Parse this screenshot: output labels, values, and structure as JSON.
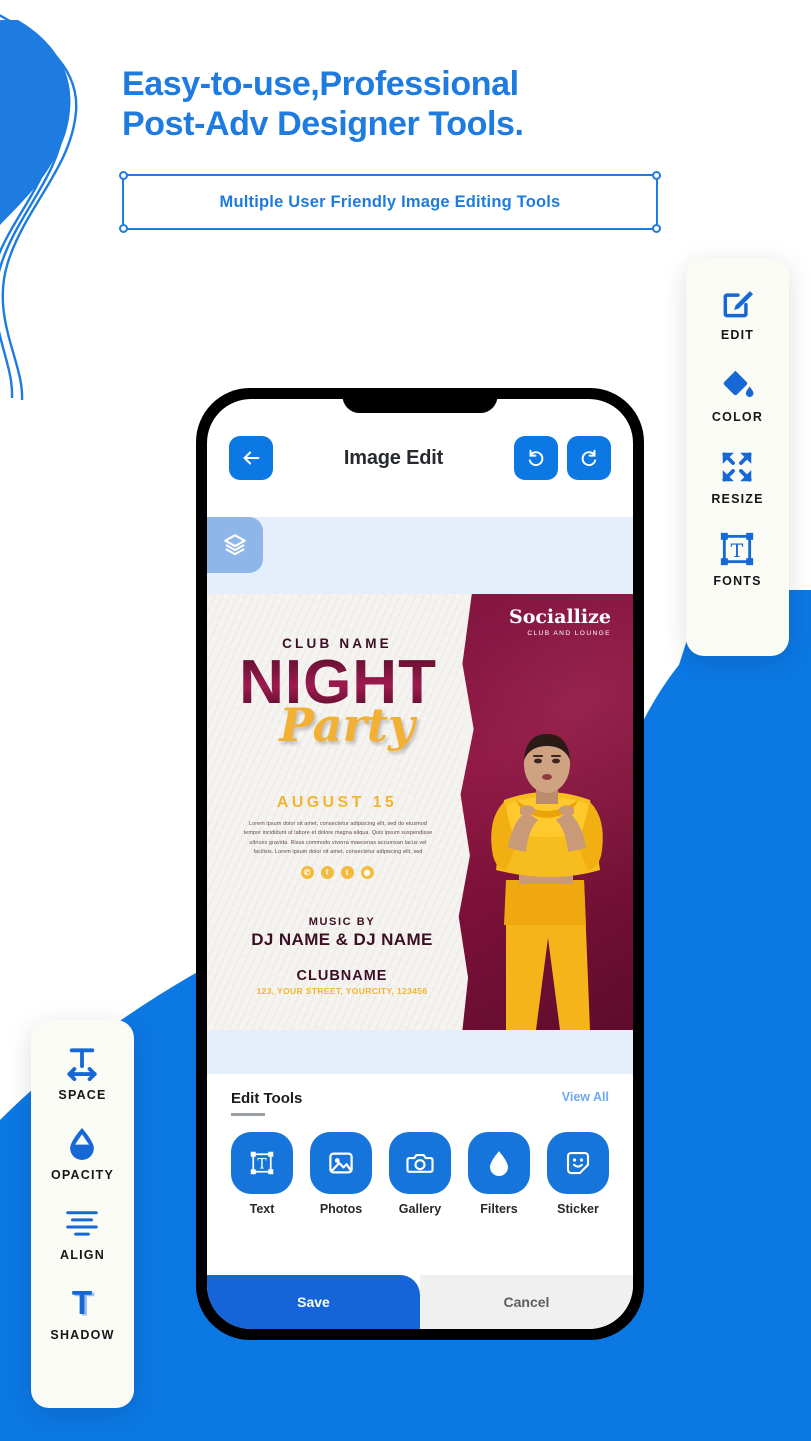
{
  "hero": {
    "headline_line1": "Easy-to-use,Professional",
    "headline_line2": "Post-Adv Designer Tools.",
    "tagline": "Multiple User Friendly Image Editing Tools",
    "accent_color": "#1E7BE0",
    "background_color": "#0C78E4"
  },
  "right_panel": {
    "items": [
      {
        "label": "EDIT",
        "icon": "edit-pencil-icon"
      },
      {
        "label": "COLOR",
        "icon": "paint-bucket-icon"
      },
      {
        "label": "RESIZE",
        "icon": "resize-arrows-icon"
      },
      {
        "label": "FONTS",
        "icon": "font-text-box-icon"
      }
    ]
  },
  "left_panel": {
    "items": [
      {
        "label": "SPACE",
        "icon": "text-spacing-icon"
      },
      {
        "label": "OPACITY",
        "icon": "opacity-droplet-icon"
      },
      {
        "label": "ALIGN",
        "icon": "align-lines-icon"
      },
      {
        "label": "SHADOW",
        "icon": "text-shadow-icon"
      }
    ]
  },
  "phone": {
    "header": {
      "title": "Image Edit",
      "back_icon": "back-arrow-icon",
      "undo_icon": "undo-icon",
      "redo_icon": "redo-icon"
    },
    "layers_icon": "layers-stack-icon",
    "poster": {
      "club_label": "CLUB NAME",
      "title_main": "NIGHT",
      "title_script": "Party",
      "date": "AUGUST 15",
      "body": "Lorem ipsum dolor sit amet, consectetur adipiscing elit, sed do eiusmod tempor incididunt ut labore et dolore magna aliqua. Quis ipsum suspendisse ultrices gravida. Risus commodo viverra maecenas accumsan lacus vel facilisis. Lorem ipsum dolor sit amet, consectetur adipiscing elit, sed",
      "social_icons": [
        "whatsapp-icon",
        "facebook-icon",
        "twitter-icon",
        "instagram-icon"
      ],
      "music_by": "MUSIC BY",
      "dj_names": "DJ NAME & DJ NAME",
      "venue": "CLUBNAME",
      "address": "123, YOUR STREET, YOURCITY, 123456",
      "brand_name": "Sociallize",
      "brand_sub": "CLUB AND LOUNGE",
      "accent_gold": "#F0B533",
      "accent_maroon": "#8E1340"
    },
    "edit_tools": {
      "section_title": "Edit Tools",
      "view_all": "View All",
      "items": [
        {
          "label": "Text",
          "icon": "text-box-icon"
        },
        {
          "label": "Photos",
          "icon": "image-icon"
        },
        {
          "label": "Gallery",
          "icon": "camera-icon"
        },
        {
          "label": "Filters",
          "icon": "droplet-icon"
        },
        {
          "label": "Sticker",
          "icon": "sticker-smiley-icon"
        }
      ]
    },
    "actions": {
      "save": "Save",
      "cancel": "Cancel"
    }
  }
}
